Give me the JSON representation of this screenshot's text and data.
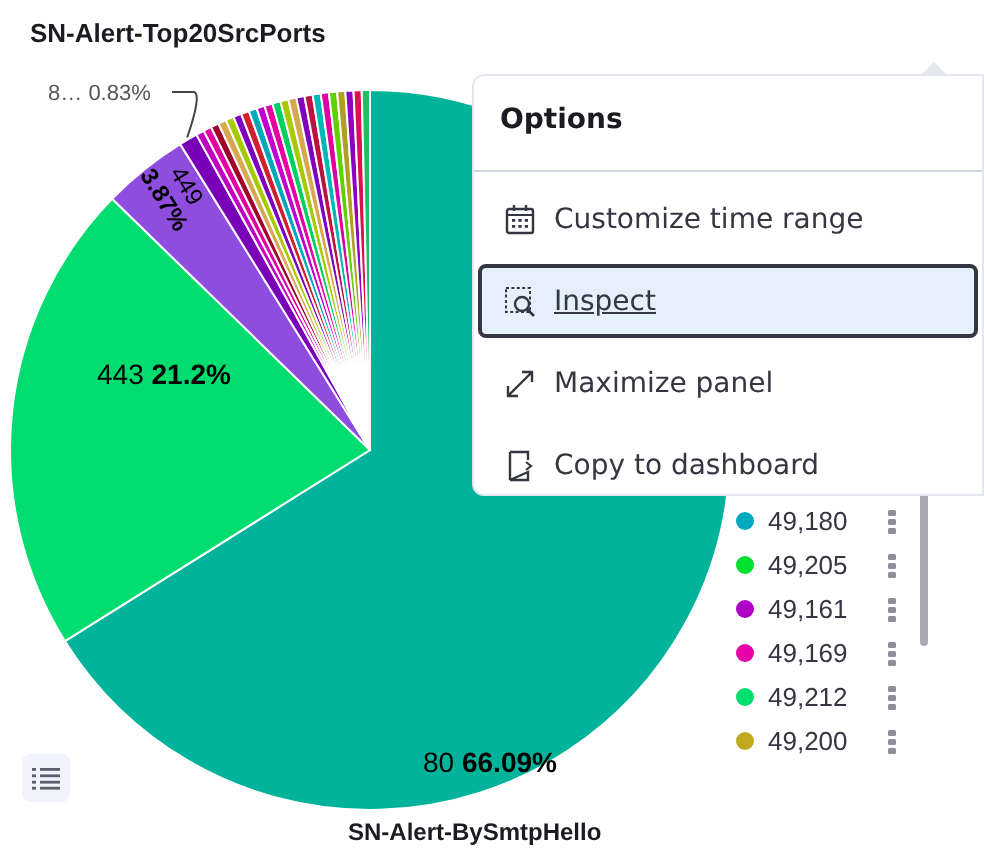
{
  "panel": {
    "title": "SN-Alert-Top20SrcPorts",
    "footer_title": "SN-Alert-BySmtpHello"
  },
  "chart": {
    "chart_data": {
      "type": "pie",
      "categories": [
        "80",
        "443",
        "449",
        "8…",
        null,
        null,
        null,
        null,
        null,
        null,
        null,
        null,
        null,
        null,
        null,
        null,
        null,
        null,
        null,
        null,
        null,
        null,
        null,
        null,
        null,
        null
      ],
      "values": [
        66.09,
        21.2,
        3.87,
        0.83,
        0.364,
        0.364,
        0.364,
        0.364,
        0.364,
        0.364,
        0.364,
        0.364,
        0.364,
        0.364,
        0.364,
        0.364,
        0.364,
        0.364,
        0.364,
        0.364,
        0.364,
        0.364,
        0.364,
        0.364,
        0.364,
        0.366
      ],
      "value_labels": [
        "66.09%",
        "21.2%",
        "3.87%",
        "0.83%",
        null,
        null,
        null,
        null,
        null,
        null,
        null,
        null,
        null,
        null,
        null,
        null,
        null,
        null,
        null,
        null,
        null,
        null,
        null,
        null,
        null,
        null
      ],
      "colors": [
        "#00b39a",
        "#00dd70",
        "#8f4de0",
        "#7a00b8",
        "#c000c0",
        "#e000a0",
        "#a0002a",
        "#d8a850",
        "#a8c800",
        "#8000c0",
        "#d02030",
        "#00a8b8",
        "#c000d0",
        "#e800a0",
        "#00d060",
        "#a8c800",
        "#d8a850",
        "#8000c0",
        "#c01040",
        "#00b8b8",
        "#e000a0",
        "#60d000",
        "#b0a020",
        "#9000c0",
        "#e01050",
        "#20c060"
      ]
    }
  },
  "legend": {
    "items": [
      {
        "label": "49,180",
        "color": "#00a8c0"
      },
      {
        "label": "49,205",
        "color": "#00e030"
      },
      {
        "label": "49,161",
        "color": "#b000c8"
      },
      {
        "label": "49,169",
        "color": "#e800a8"
      },
      {
        "label": "49,212",
        "color": "#00e070"
      },
      {
        "label": "49,200",
        "color": "#c0a820"
      }
    ]
  },
  "menu": {
    "title": "Options",
    "items": [
      {
        "kind": "calendar",
        "label": "Customize time range",
        "selected": false
      },
      {
        "kind": "inspect",
        "label": "Inspect",
        "selected": true
      },
      {
        "kind": "maximize",
        "label": "Maximize panel",
        "selected": false
      },
      {
        "kind": "copy",
        "label": "Copy to dashboard",
        "selected": false
      }
    ]
  }
}
